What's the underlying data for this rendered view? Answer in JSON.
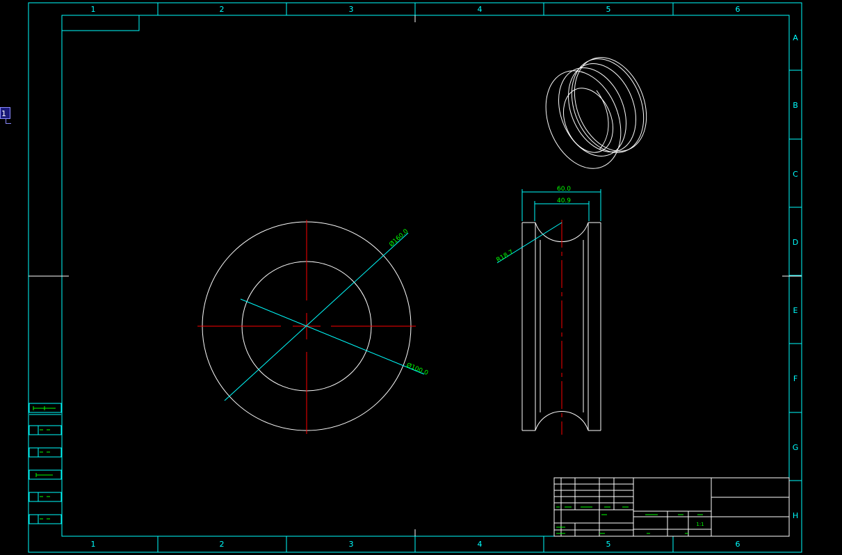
{
  "viewport_marker": "1",
  "zones": {
    "columns": [
      "1",
      "2",
      "3",
      "4",
      "5",
      "6"
    ],
    "rows": [
      "A",
      "B",
      "C",
      "D",
      "E",
      "F",
      "G",
      "H"
    ]
  },
  "dimensions": {
    "outer_diameter": "Ø160.0",
    "inner_diameter": "Ø100.0",
    "overall_width": "60.0",
    "groove_width": "40.9",
    "groove_radius": "R18.7"
  },
  "title_block": {
    "qty_value": "1:1"
  },
  "colors": {
    "background": "#000000",
    "frame": "#00ffff",
    "geometry": "#ffffff",
    "centerline": "#ff0000",
    "dimension": "#00ffff",
    "text": "#00ff00"
  }
}
